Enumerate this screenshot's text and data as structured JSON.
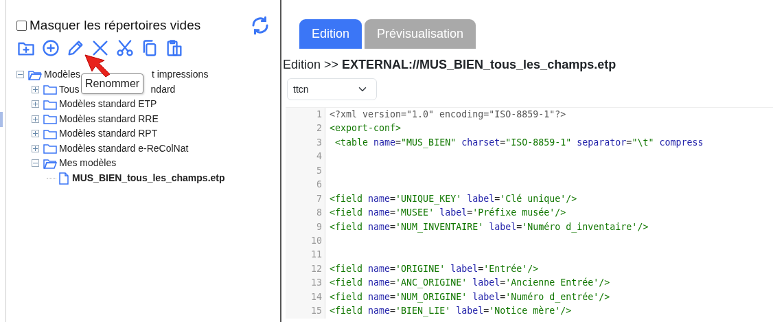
{
  "sidebar": {
    "hide_empty": {
      "label": "Masquer les répertoires vides",
      "checked": false
    },
    "toolbar": [
      {
        "kind": "new-folder"
      },
      {
        "kind": "add"
      },
      {
        "kind": "rename"
      },
      {
        "kind": "delete"
      },
      {
        "kind": "cut"
      },
      {
        "kind": "copy"
      },
      {
        "kind": "paste"
      }
    ],
    "tooltip": "Renommer",
    "tree": [
      {
        "label_parts": [
          "Modèles",
          "t impressions"
        ],
        "kind": "folder",
        "expanded": true,
        "children": [
          {
            "label_parts": [
              "Tous",
              "ndard"
            ],
            "kind": "folder",
            "expanded": false
          },
          {
            "label_parts": [
              "Modèles standard ETP"
            ],
            "kind": "folder",
            "expanded": false
          },
          {
            "label_parts": [
              "Modèles standard RRE"
            ],
            "kind": "folder",
            "expanded": false
          },
          {
            "label_parts": [
              "Modèles standard RPT"
            ],
            "kind": "folder",
            "expanded": false
          },
          {
            "label_parts": [
              "Modèles standard e-ReColNat"
            ],
            "kind": "folder",
            "expanded": false
          },
          {
            "label_parts": [
              "Mes modèles"
            ],
            "kind": "folder",
            "expanded": true,
            "children": [
              {
                "label_parts": [
                  "MUS_BIEN_tous_les_champs.etp"
                ],
                "kind": "file",
                "selected": true
              }
            ]
          }
        ]
      }
    ]
  },
  "tabs": [
    {
      "label": "Edition",
      "selected": true
    },
    {
      "label": "Prévisualisation",
      "selected": false
    }
  ],
  "breadcrumb": {
    "prefix": "Edition >> ",
    "path": "EXTERNAL://MUS_BIEN_tous_les_champs.etp"
  },
  "mode_select": {
    "value": "ttcn"
  },
  "code": [
    {
      "number": "1",
      "tokens": [
        {
          "kind": "decl",
          "text": "<?xml version=\"1.0\" encoding=\"ISO-8859-1\"?>"
        }
      ]
    },
    {
      "number": "2",
      "tokens": [
        {
          "kind": "tag",
          "text": "<export-conf>"
        }
      ]
    },
    {
      "number": "3",
      "tokens": [
        {
          "kind": "tag",
          "text": " <table"
        },
        {
          "kind": "attr",
          "text": " name"
        },
        {
          "kind": "eq",
          "text": "="
        },
        {
          "kind": "val",
          "text": "\"MUS_BIEN\""
        },
        {
          "kind": "attr",
          "text": " charset"
        },
        {
          "kind": "eq",
          "text": "="
        },
        {
          "kind": "val",
          "text": "\"ISO-8859-1\""
        },
        {
          "kind": "attr",
          "text": " separator"
        },
        {
          "kind": "eq",
          "text": "="
        },
        {
          "kind": "val",
          "text": "\"\\t\""
        },
        {
          "kind": "attr",
          "text": " compress"
        }
      ]
    },
    {
      "number": "4"
    },
    {
      "number": "5"
    },
    {
      "number": "6"
    },
    {
      "number": "7",
      "tokens": [
        {
          "kind": "tag",
          "text": "<field"
        },
        {
          "kind": "attr",
          "text": " name"
        },
        {
          "kind": "eq",
          "text": "="
        },
        {
          "kind": "val",
          "text": "'UNIQUE_KEY'"
        },
        {
          "kind": "attr",
          "text": " label"
        },
        {
          "kind": "eq",
          "text": "="
        },
        {
          "kind": "val",
          "text": "'Clé unique'"
        },
        {
          "kind": "tag",
          "text": "/>"
        }
      ]
    },
    {
      "number": "8",
      "tokens": [
        {
          "kind": "tag",
          "text": "<field"
        },
        {
          "kind": "attr",
          "text": " name"
        },
        {
          "kind": "eq",
          "text": "="
        },
        {
          "kind": "val",
          "text": "'MUSEE'"
        },
        {
          "kind": "attr",
          "text": " label"
        },
        {
          "kind": "eq",
          "text": "="
        },
        {
          "kind": "val",
          "text": "'Préfixe musée'"
        },
        {
          "kind": "tag",
          "text": "/>"
        }
      ]
    },
    {
      "number": "9",
      "tokens": [
        {
          "kind": "tag",
          "text": "<field"
        },
        {
          "kind": "attr",
          "text": " name"
        },
        {
          "kind": "eq",
          "text": "="
        },
        {
          "kind": "val",
          "text": "'NUM_INVENTAIRE'"
        },
        {
          "kind": "attr",
          "text": " label"
        },
        {
          "kind": "eq",
          "text": "="
        },
        {
          "kind": "val",
          "text": "'Numéro d_inventaire'"
        },
        {
          "kind": "tag",
          "text": "/>"
        }
      ]
    },
    {
      "number": "10"
    },
    {
      "number": "11"
    },
    {
      "number": "12",
      "tokens": [
        {
          "kind": "tag",
          "text": "<field"
        },
        {
          "kind": "attr",
          "text": " name"
        },
        {
          "kind": "eq",
          "text": "="
        },
        {
          "kind": "val",
          "text": "'ORIGINE'"
        },
        {
          "kind": "attr",
          "text": " label"
        },
        {
          "kind": "eq",
          "text": "="
        },
        {
          "kind": "val",
          "text": "'Entrée'"
        },
        {
          "kind": "tag",
          "text": "/>"
        }
      ]
    },
    {
      "number": "13",
      "tokens": [
        {
          "kind": "tag",
          "text": "<field"
        },
        {
          "kind": "attr",
          "text": " name"
        },
        {
          "kind": "eq",
          "text": "="
        },
        {
          "kind": "val",
          "text": "'ANC_ORIGINE'"
        },
        {
          "kind": "attr",
          "text": " label"
        },
        {
          "kind": "eq",
          "text": "="
        },
        {
          "kind": "val",
          "text": "'Ancienne Entrée'"
        },
        {
          "kind": "tag",
          "text": "/>"
        }
      ]
    },
    {
      "number": "14",
      "tokens": [
        {
          "kind": "tag",
          "text": "<field"
        },
        {
          "kind": "attr",
          "text": " name"
        },
        {
          "kind": "eq",
          "text": "="
        },
        {
          "kind": "val",
          "text": "'NUM_ORIGINE'"
        },
        {
          "kind": "attr",
          "text": " label"
        },
        {
          "kind": "eq",
          "text": "="
        },
        {
          "kind": "val",
          "text": "'Numéro d_entrée'"
        },
        {
          "kind": "tag",
          "text": "/>"
        }
      ]
    },
    {
      "number": "15",
      "tokens": [
        {
          "kind": "tag",
          "text": "<field"
        },
        {
          "kind": "attr",
          "text": " name"
        },
        {
          "kind": "eq",
          "text": "="
        },
        {
          "kind": "val",
          "text": "'BIEN_LIE'"
        },
        {
          "kind": "attr",
          "text": " label"
        },
        {
          "kind": "eq",
          "text": "="
        },
        {
          "kind": "val",
          "text": "'Notice mère'"
        },
        {
          "kind": "tag",
          "text": "/>"
        }
      ]
    }
  ]
}
